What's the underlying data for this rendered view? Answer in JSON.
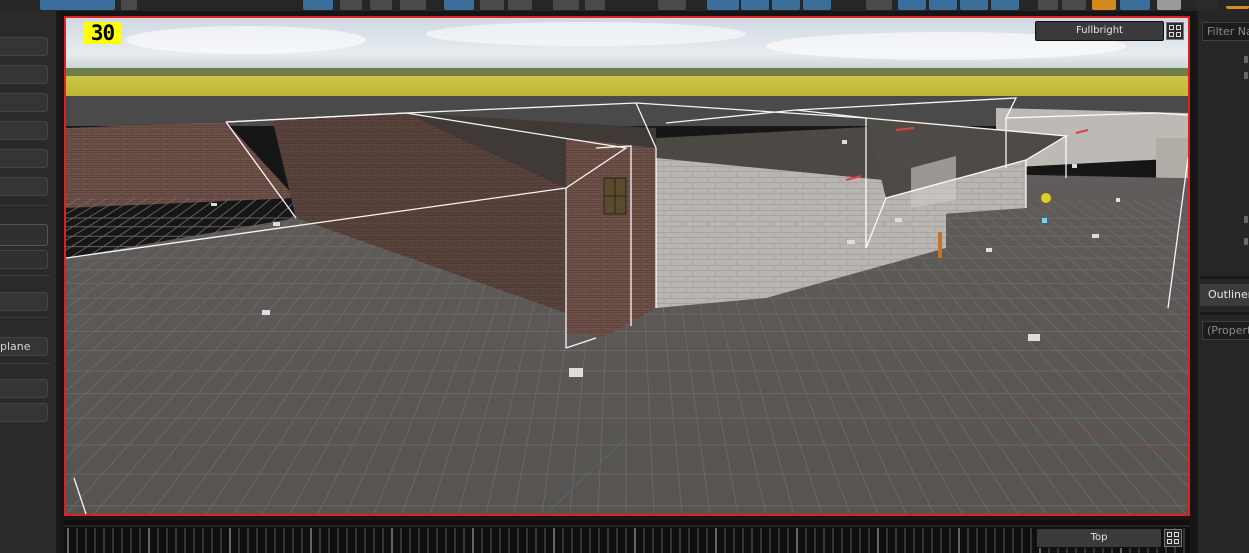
{
  "viewport": {
    "fps": "30",
    "render_mode": "Fullbright",
    "bottom_view": "Top",
    "grid_toggle_icon": "grid-layout-icon"
  },
  "left_panel": {
    "partial_field_text": "plane"
  },
  "right_panel": {
    "filter_placeholder": "Filter Na",
    "outliner_tab": "Outliner",
    "properties_placeholder": "(Propert"
  },
  "colors": {
    "selection_border": "#e02020",
    "fps_badge": "#ffff00",
    "active_tool": "#3a6f9c",
    "accent_orange": "#d48a1e"
  }
}
